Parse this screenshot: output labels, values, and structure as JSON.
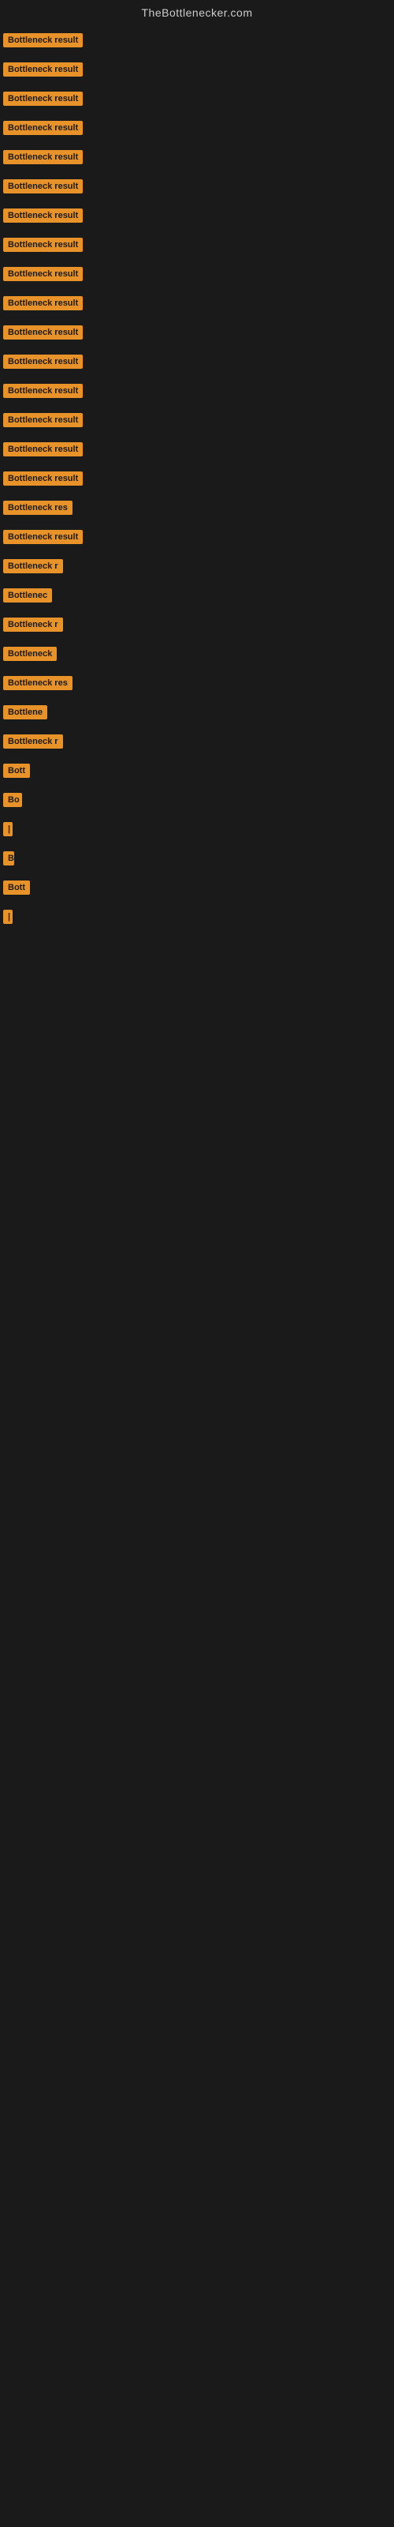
{
  "site": {
    "title": "TheBottlenecker.com"
  },
  "items": [
    {
      "label": "Bottleneck result",
      "width": 110
    },
    {
      "label": "Bottleneck result",
      "width": 110
    },
    {
      "label": "Bottleneck result",
      "width": 110
    },
    {
      "label": "Bottleneck result",
      "width": 110
    },
    {
      "label": "Bottleneck result",
      "width": 110
    },
    {
      "label": "Bottleneck result",
      "width": 110
    },
    {
      "label": "Bottleneck result",
      "width": 110
    },
    {
      "label": "Bottleneck result",
      "width": 110
    },
    {
      "label": "Bottleneck result",
      "width": 110
    },
    {
      "label": "Bottleneck result",
      "width": 110
    },
    {
      "label": "Bottleneck result",
      "width": 110
    },
    {
      "label": "Bottleneck result",
      "width": 110
    },
    {
      "label": "Bottleneck result",
      "width": 110
    },
    {
      "label": "Bottleneck result",
      "width": 110
    },
    {
      "label": "Bottleneck result",
      "width": 110
    },
    {
      "label": "Bottleneck result",
      "width": 110
    },
    {
      "label": "Bottleneck res",
      "width": 95
    },
    {
      "label": "Bottleneck result",
      "width": 110
    },
    {
      "label": "Bottleneck r",
      "width": 80
    },
    {
      "label": "Bottlenec",
      "width": 68
    },
    {
      "label": "Bottleneck r",
      "width": 80
    },
    {
      "label": "Bottleneck",
      "width": 72
    },
    {
      "label": "Bottleneck res",
      "width": 95
    },
    {
      "label": "Bottlene",
      "width": 62
    },
    {
      "label": "Bottleneck r",
      "width": 80
    },
    {
      "label": "Bott",
      "width": 36
    },
    {
      "label": "Bo",
      "width": 24
    },
    {
      "label": "|",
      "width": 8
    },
    {
      "label": "B",
      "width": 14
    },
    {
      "label": "Bott",
      "width": 36
    },
    {
      "label": "|",
      "width": 8
    }
  ],
  "colors": {
    "background": "#1a1a1a",
    "label_bg": "#e8922a",
    "label_text": "#1a1a1a",
    "site_title": "#cccccc"
  }
}
